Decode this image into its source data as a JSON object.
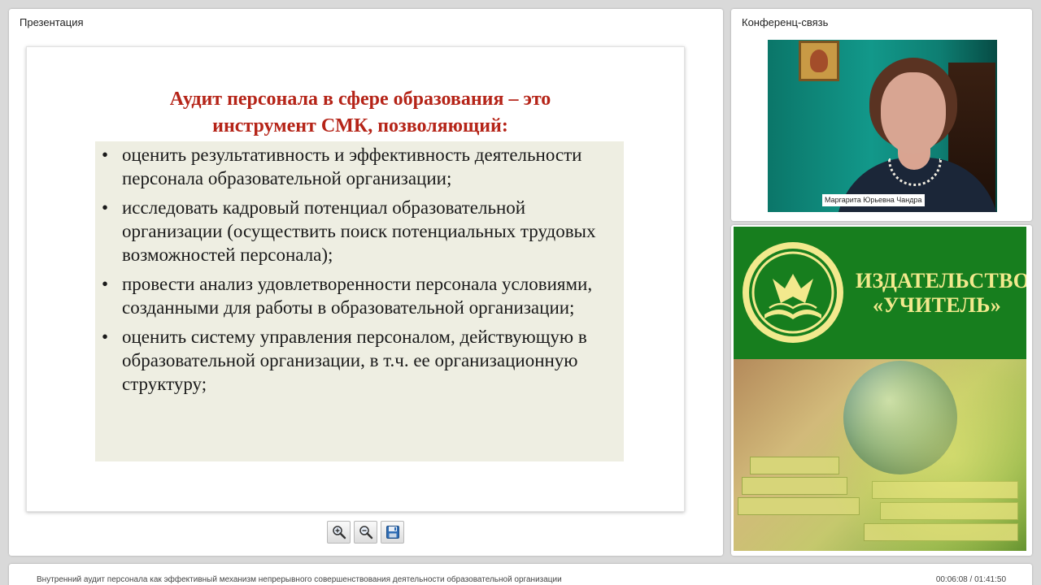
{
  "presentation": {
    "panel_title": "Презентация",
    "slide": {
      "title_line1": "Аудит персонала в сфере образования – это",
      "title_line2": "инструмент СМК, позволяющий:",
      "bullets": [
        "оценить результативность и эффективность деятельности персонала образовательной организации;",
        "исследовать кадровый потенциал образовательной организации (осуществить поиск потенциальных трудовых возможностей персонала);",
        "провести анализ удовлетворенности персонала условиями, созданными для работы в образовательной организации;",
        "оценить систему управления персоналом, действующую в образовательной организации, в т.ч. ее организационную структуру;"
      ]
    },
    "toolbar": {
      "zoom_in_icon": "zoom-in-icon",
      "zoom_out_icon": "zoom-out-icon",
      "save_icon": "floppy-disk-icon"
    }
  },
  "conference": {
    "panel_title": "Конференц-связь",
    "speaker_name": "Маргарита Юрьевна Чандра"
  },
  "publisher": {
    "name_line1": "ИЗДАТЕЛЬСТВО",
    "name_line2": "«УЧИТЕЛЬ»",
    "colors": {
      "green": "#177e1e",
      "gold": "#f2e98d"
    }
  },
  "footer": {
    "title": "Внутренний аудит персонала как эффективный механизм непрерывного совершенствования деятельности образовательной организации",
    "time": "00:06:08 / 01:41:50"
  },
  "colors": {
    "slide_title": "#b52418",
    "slide_box": "#eeeee2"
  }
}
